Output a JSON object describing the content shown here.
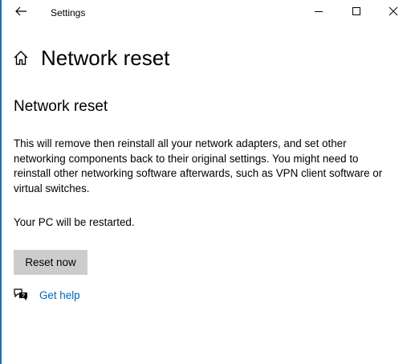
{
  "window": {
    "title": "Settings",
    "icons": {
      "back": "back-arrow-icon",
      "minimize": "minimize-icon",
      "maximize": "maximize-icon",
      "close": "close-icon"
    }
  },
  "header": {
    "title": "Network reset",
    "icon": "home-icon"
  },
  "main": {
    "section_title": "Network reset",
    "description": "This will remove then reinstall all your network adapters, and set other networking components back to their original settings. You might need to reinstall other networking software afterwards, such as VPN client software or virtual switches.",
    "restart_note": "Your PC will be restarted.",
    "reset_button_label": "Reset now",
    "help_link_label": "Get help",
    "help_icon": "chat-help-icon"
  },
  "colors": {
    "accent": "#0067b8",
    "button_bg": "#cccccc",
    "frame_edge": "#1f6fb0"
  }
}
